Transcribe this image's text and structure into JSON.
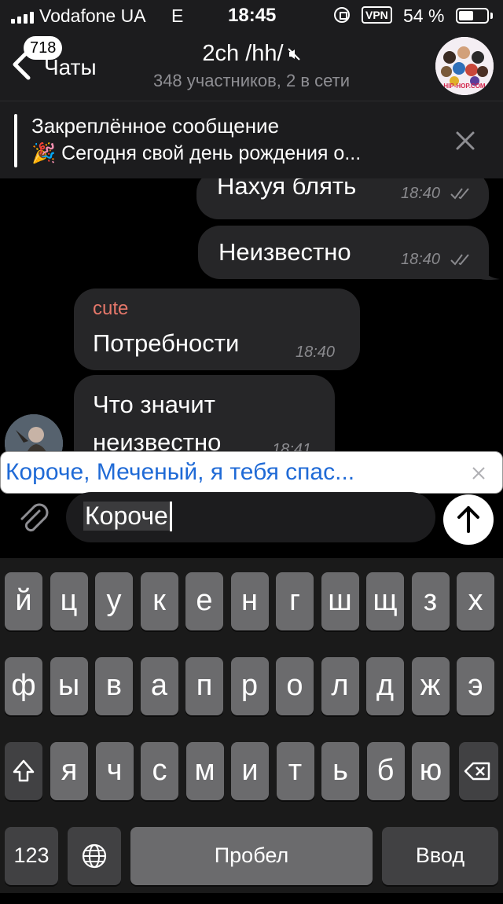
{
  "status_bar": {
    "carrier": "Vodafone UA",
    "network": "E",
    "time": "18:45",
    "vpn": "VPN",
    "battery_percent": "54 %",
    "battery_level": 0.54
  },
  "header": {
    "back_badge": "718",
    "back_label": "Чаты",
    "title": "2ch /hh/",
    "subtitle": "348 участников, 2 в сети",
    "avatar_text": "HIP-HOP.COM"
  },
  "pinned": {
    "title": "Закреплённое сообщение",
    "text": "🎉 Сегодня свой день рождения о..."
  },
  "messages": [
    {
      "text": "Нахуя блять",
      "time": "18:40"
    },
    {
      "text": "Неизвестно",
      "time": "18:40"
    },
    {
      "sender": "cute",
      "text": "Потребности",
      "time": "18:40"
    },
    {
      "text_line1": "Что значит",
      "text_line2": "неизвестно",
      "time": "18:41"
    }
  ],
  "suggestion": {
    "text": "Короче, Меченый, я тебя спас..."
  },
  "input": {
    "value": "Короче"
  },
  "keyboard": {
    "row1": [
      "й",
      "ц",
      "у",
      "к",
      "е",
      "н",
      "г",
      "ш",
      "щ",
      "з",
      "х"
    ],
    "row2": [
      "ф",
      "ы",
      "в",
      "а",
      "п",
      "р",
      "о",
      "л",
      "д",
      "ж",
      "э"
    ],
    "row3": [
      "я",
      "ч",
      "с",
      "м",
      "и",
      "т",
      "ь",
      "б",
      "ю"
    ],
    "numbers_label": "123",
    "space_label": "Пробел",
    "return_label": "Ввод"
  },
  "colors": {
    "accent_link": "#1f6ad6",
    "sender_name": "#e5776a",
    "bubble": "#262628",
    "bar": "#1c1c1e"
  }
}
